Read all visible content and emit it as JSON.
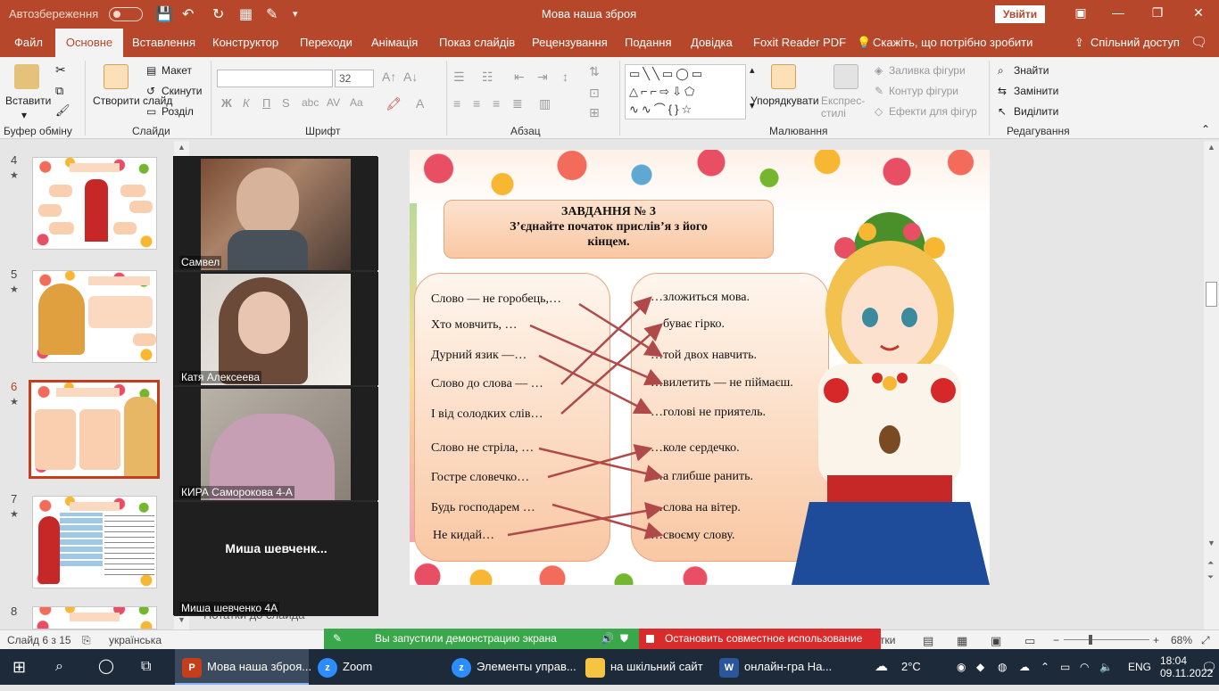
{
  "titlebar": {
    "autosave": "Автозбереження",
    "title": "Мова наша зброя",
    "signin": "Увійти"
  },
  "tabs": [
    "Файл",
    "Основне",
    "Вставлення",
    "Конструктор",
    "Переходи",
    "Анімація",
    "Показ слайдів",
    "Рецензування",
    "Подання",
    "Довідка",
    "Foxit Reader PDF",
    "Скажіть, що потрібно зробити",
    "Спільний доступ"
  ],
  "ribbon": {
    "paste": "Вставити",
    "new_slide": "Створити слайд",
    "layout": "Макет",
    "reset": "Скинути",
    "section": "Розділ",
    "font_size": "32",
    "bold": "Ж",
    "italic": "К",
    "underline": "П",
    "strike": "S",
    "arrange": "Упорядкувати",
    "quick_styles": "Експрес-стилі",
    "shape_fill": "Заливка фігури",
    "shape_outline": "Контур фігури",
    "shape_effects": "Ефекти для фігур",
    "find": "Знайти",
    "replace": "Замінити",
    "select": "Виділити",
    "groups": {
      "clipboard": "Буфер обміну",
      "slides": "Слайди",
      "font": "Шрифт",
      "paragraph": "Абзац",
      "drawing": "Малювання",
      "editing": "Редагування"
    }
  },
  "thumbnails": [
    {
      "num": "4",
      "star": "★"
    },
    {
      "num": "5",
      "star": "★"
    },
    {
      "num": "6",
      "star": "★"
    },
    {
      "num": "7",
      "star": "★"
    },
    {
      "num": "8",
      "star": ""
    }
  ],
  "video": {
    "p1": "Самвел",
    "p2": "Катя Алексеева",
    "p3": "КИРА Саморокова 4-А",
    "p4_big": "Миша  шевченк...",
    "p4": "Миша шевченко 4А"
  },
  "slide": {
    "task_title": "ЗАВДАННЯ № 3",
    "task_text_1": "З’єднайте початок прислів’я з його",
    "task_text_2": "кінцем.",
    "left": [
      "Слово — не горобець,…",
      "Хто мовчить, …",
      "Дурний язик —…",
      "Слово до слова — …",
      "І від солодких слів…",
      "Слово не стріла, …",
      "Гостре словечко…",
      "Будь господарем …",
      "Не кидай…"
    ],
    "right": [
      "…зложиться мова.",
      "…буває гірко.",
      "…той двох навчить.",
      "…вилетить — не піймаєш.",
      "…голові не приятель.",
      "…коле сердечко.",
      "…а глибше ранить.",
      "…слова на вітер.",
      "…своєму слову."
    ]
  },
  "notes": "Нотатки до слайда",
  "status": {
    "slide": "Слайд 6 з 15",
    "lang": "українська",
    "share": "Вы запустили демонстрацию экрана",
    "stop": "Остановить совместное использование",
    "notes_btn": "тки",
    "zoom": "68%"
  },
  "taskbar": {
    "ppt": "Мова наша зброя...",
    "zoom": "Zoom",
    "zoom_controls": "Элементы управ...",
    "folder": "на шкільний сайт",
    "word": "онлайн-гра На...",
    "temp": "2°C",
    "lang": "ENG",
    "time": "18:04",
    "date": "09.11.2022"
  },
  "colors": {
    "accent": "#b7472a",
    "active": "#c43e1c",
    "share": "#3aa84a",
    "stop": "#d92b2b",
    "taskbar": "#1d2a3a"
  }
}
